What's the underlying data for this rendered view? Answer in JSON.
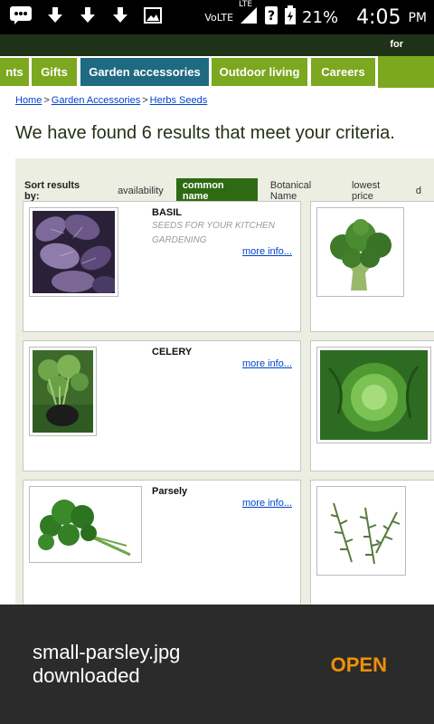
{
  "status_bar": {
    "network": "VoLTE",
    "lte": "LTE",
    "battery": "21%",
    "time": "4:05",
    "ampm": "PM"
  },
  "topbar": {
    "text": "for"
  },
  "nav": {
    "tabs": [
      {
        "label": "nts"
      },
      {
        "label": "Gifts"
      },
      {
        "label": "Garden accessories",
        "active": true
      },
      {
        "label": "Outdoor living"
      },
      {
        "label": "Careers"
      }
    ]
  },
  "breadcrumb": [
    {
      "label": "Home"
    },
    {
      "label": "Garden Accessories"
    },
    {
      "label": "Herbs Seeds"
    }
  ],
  "breadcrumb_sep": ">",
  "results_heading": "We have found 6 results that meet your criteria.",
  "sort": {
    "label": "Sort results by:",
    "options": [
      "availability",
      "common name",
      "Botanical Name",
      "lowest price",
      "d"
    ],
    "active": "common name"
  },
  "products": [
    {
      "name": "BASIL",
      "description": "SEEDS FOR YOUR KITCHEN GARDENING",
      "more": "more info...",
      "image": "purple-basil"
    },
    {
      "name": "",
      "image": "broccoli"
    },
    {
      "name": "CELERY",
      "more": "more info...",
      "image": "celery-plant"
    },
    {
      "name": "",
      "image": "lettuce"
    },
    {
      "name": "Parsely",
      "more": "more info...",
      "image": "parsley"
    },
    {
      "name": "",
      "image": "rosemary"
    }
  ],
  "toast": {
    "message_line1": "small-parsley.jpg",
    "message_line2": "downloaded",
    "action": "OPEN"
  },
  "colors": {
    "nav_green": "#7ca81f",
    "nav_active": "#1e6a80",
    "sort_active": "#2d6a12",
    "toast_action": "#f0900a"
  }
}
